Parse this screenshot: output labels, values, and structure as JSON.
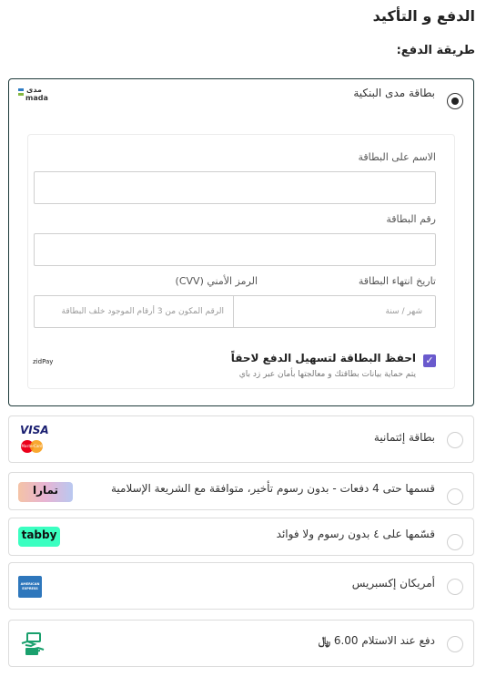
{
  "header": {
    "title": "الدفع و التأكيد",
    "payment_method_label": "طريقة الدفع:"
  },
  "mada": {
    "label": "بطاقة مدى البنكية",
    "logo_ar": "مدى",
    "logo_en": "mada",
    "form": {
      "name_label": "الاسم على البطاقة",
      "number_label": "رقم البطاقة",
      "expiry_label": "تاريخ انتهاء البطاقة",
      "cvv_label": "الرمز الأمني (CVV)",
      "expiry_placeholder": "شهر / سنة",
      "cvv_placeholder": "الرقم المكون من 3 أرقام الموجود خلف البطاقة",
      "save_label": "احفظ البطاقة لتسهيل الدفع لاحقاً",
      "save_sub": "يتم حماية بيانات بطاقتك و معالجتها بأمان عبر زد باي",
      "provider": "zidPay"
    }
  },
  "options": {
    "credit": {
      "label": "بطاقة إئتمانية",
      "visa": "VISA",
      "mastercard": "MasterCard"
    },
    "tamara": {
      "label": "قسمها حتى 4 دفعات - بدون رسوم تأخير، متوافقة مع الشريعة الإسلامية",
      "logo": "تمارا"
    },
    "tabby": {
      "label": "قسّمها على ٤ بدون رسوم ولا فوائد",
      "logo": "tabby"
    },
    "amex": {
      "label": "أمريكان إكسبريس",
      "logo": "AMERICAN EXPRESS"
    },
    "cod": {
      "label": "دفع عند الاستلام 6.00",
      "currency": "﷼"
    }
  },
  "colors": {
    "selected_border": "#1e3a3a",
    "checkbox": "#6a5acd",
    "tabby_green": "#3bffc1",
    "amex_blue": "#2e77bc",
    "cod_green": "#1aa06d"
  }
}
